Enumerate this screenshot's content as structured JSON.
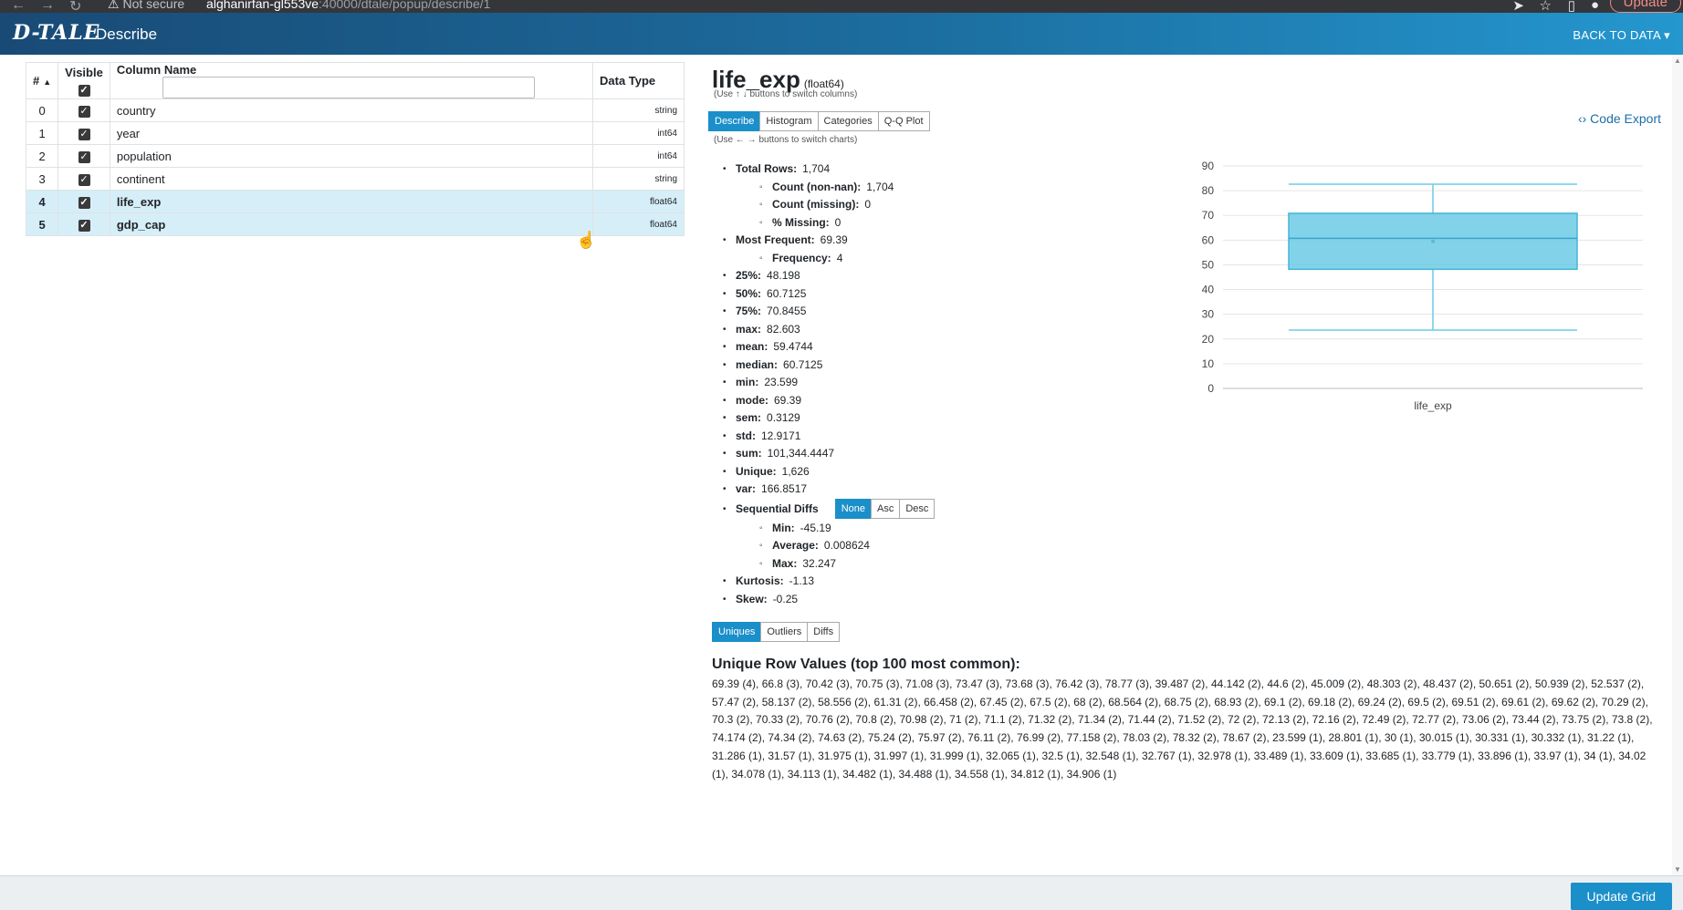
{
  "browser": {
    "not_secure": "Not secure",
    "url_host": "alghanirfan-gl553ve",
    "url_path": ":40000/dtale/popup/describe/1",
    "update_label": "Update"
  },
  "header": {
    "logo": "D-TALE",
    "title": "Describe",
    "back_label": "BACK TO DATA"
  },
  "columns_table": {
    "headers": {
      "index": "#",
      "visible": "Visible",
      "name": "Column Name",
      "dtype": "Data Type"
    },
    "rows": [
      {
        "index": "0",
        "name": "country",
        "dtype": "string"
      },
      {
        "index": "1",
        "name": "year",
        "dtype": "int64"
      },
      {
        "index": "2",
        "name": "population",
        "dtype": "int64"
      },
      {
        "index": "3",
        "name": "continent",
        "dtype": "string"
      },
      {
        "index": "4",
        "name": "life_exp",
        "dtype": "float64"
      },
      {
        "index": "5",
        "name": "gdp_cap",
        "dtype": "float64"
      }
    ]
  },
  "details": {
    "column": "life_exp",
    "dtype": "(float64)",
    "hint_columns": "(Use ↑ ↓ buttons to switch columns)",
    "hint_charts": "(Use ← → buttons to switch charts)",
    "chart_tabs": [
      "Describe",
      "Histogram",
      "Categories",
      "Q-Q Plot"
    ],
    "code_export": "Code Export",
    "stats": {
      "total_rows": {
        "label": "Total Rows:",
        "value": "1,704"
      },
      "count_non_nan": {
        "label": "Count (non-nan):",
        "value": "1,704"
      },
      "count_missing": {
        "label": "Count (missing):",
        "value": "0"
      },
      "pct_missing": {
        "label": "% Missing:",
        "value": "0"
      },
      "most_frequent": {
        "label": "Most Frequent:",
        "value": "69.39"
      },
      "frequency": {
        "label": "Frequency:",
        "value": "4"
      },
      "p25": {
        "label": "25%:",
        "value": "48.198"
      },
      "p50": {
        "label": "50%:",
        "value": "60.7125"
      },
      "p75": {
        "label": "75%:",
        "value": "70.8455"
      },
      "max": {
        "label": "max:",
        "value": "82.603"
      },
      "mean": {
        "label": "mean:",
        "value": "59.4744"
      },
      "median": {
        "label": "median:",
        "value": "60.7125"
      },
      "min": {
        "label": "min:",
        "value": "23.599"
      },
      "mode": {
        "label": "mode:",
        "value": "69.39"
      },
      "sem": {
        "label": "sem:",
        "value": "0.3129"
      },
      "std": {
        "label": "std:",
        "value": "12.9171"
      },
      "sum": {
        "label": "sum:",
        "value": "101,344.4447"
      },
      "unique": {
        "label": "Unique:",
        "value": "1,626"
      },
      "var": {
        "label": "var:",
        "value": "166.8517"
      },
      "seq_diffs": {
        "label": "Sequential Diffs",
        "options": [
          "None",
          "Asc",
          "Desc"
        ]
      },
      "seq_min": {
        "label": "Min:",
        "value": "-45.19"
      },
      "seq_avg": {
        "label": "Average:",
        "value": "0.008624"
      },
      "seq_max": {
        "label": "Max:",
        "value": "32.247"
      },
      "kurtosis": {
        "label": "Kurtosis:",
        "value": "-1.13"
      },
      "skew": {
        "label": "Skew:",
        "value": "-0.25"
      }
    },
    "bottom_tabs": [
      "Uniques",
      "Outliers",
      "Diffs"
    ],
    "unique_title": "Unique Row Values (top 100 most common):",
    "unique_values": "69.39 (4), 66.8 (3), 70.42 (3), 70.75 (3), 71.08 (3), 73.47 (3), 73.68 (3), 76.42 (3), 78.77 (3), 39.487 (2), 44.142 (2), 44.6 (2), 45.009 (2), 48.303 (2), 48.437 (2), 50.651 (2), 50.939 (2), 52.537 (2), 57.47 (2), 58.137 (2), 58.556 (2), 61.31 (2), 66.458 (2), 67.45 (2), 67.5 (2), 68 (2), 68.564 (2), 68.75 (2), 68.93 (2), 69.1 (2), 69.18 (2), 69.24 (2), 69.5 (2), 69.51 (2), 69.61 (2), 69.62 (2), 70.29 (2), 70.3 (2), 70.33 (2), 70.76 (2), 70.8 (2), 70.98 (2), 71 (2), 71.1 (2), 71.32 (2), 71.34 (2), 71.44 (2), 71.52 (2), 72 (2), 72.13 (2), 72.16 (2), 72.49 (2), 72.77 (2), 73.06 (2), 73.44 (2), 73.75 (2), 73.8 (2), 74.174 (2), 74.34 (2), 74.63 (2), 75.24 (2), 75.97 (2), 76.11 (2), 76.99 (2), 77.158 (2), 78.03 (2), 78.32 (2), 78.67 (2), 23.599 (1), 28.801 (1), 30 (1), 30.015 (1), 30.331 (1), 30.332 (1), 31.22 (1), 31.286 (1), 31.57 (1), 31.975 (1), 31.997 (1), 31.999 (1), 32.065 (1), 32.5 (1), 32.548 (1), 32.767 (1), 32.978 (1), 33.489 (1), 33.609 (1), 33.685 (1), 33.779 (1), 33.896 (1), 33.97 (1), 34 (1), 34.02 (1), 34.078 (1), 34.113 (1), 34.482 (1), 34.488 (1), 34.558 (1), 34.812 (1), 34.906 (1)"
  },
  "chart_data": {
    "type": "box",
    "categories": [
      "life_exp"
    ],
    "box": {
      "min": 23.599,
      "q1": 48.198,
      "median": 60.7125,
      "q3": 70.8455,
      "max": 82.603,
      "mean": 59.4744
    },
    "ylim": [
      0,
      90
    ],
    "yticks": [
      0,
      10,
      20,
      30,
      40,
      50,
      60,
      70,
      80,
      90
    ],
    "color": "#6ccbe6"
  },
  "footer": {
    "update_grid": "Update Grid"
  }
}
